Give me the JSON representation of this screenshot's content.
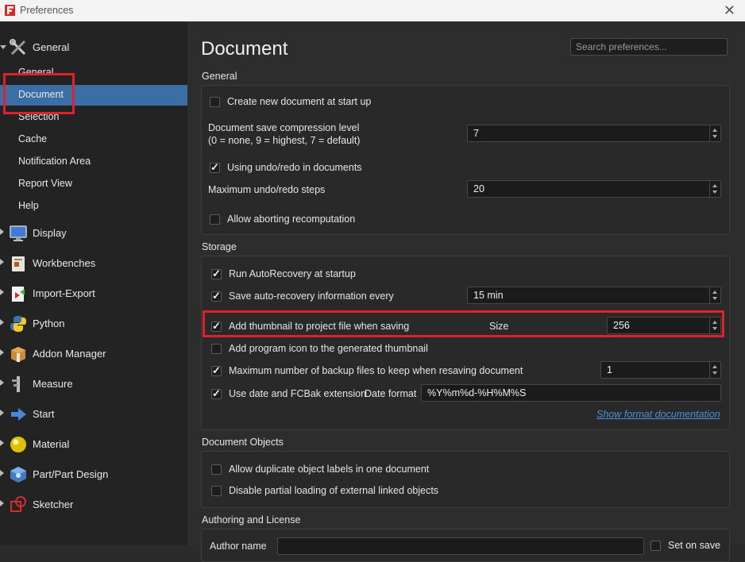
{
  "window": {
    "title": "Preferences",
    "close_glyph": "✕"
  },
  "sidebar": {
    "groups": [
      {
        "label": "General",
        "icon": "tools-icon",
        "expanded": true
      },
      {
        "label": "Display",
        "icon": "monitor-icon"
      },
      {
        "label": "Workbenches",
        "icon": "workbench-icon"
      },
      {
        "label": "Import-Export",
        "icon": "import-export-icon"
      },
      {
        "label": "Python",
        "icon": "python-icon"
      },
      {
        "label": "Addon Manager",
        "icon": "addon-box-icon"
      },
      {
        "label": "Measure",
        "icon": "caliper-icon"
      },
      {
        "label": "Start",
        "icon": "arrow-right-icon"
      },
      {
        "label": "Material",
        "icon": "sphere-icon"
      },
      {
        "label": "Part/Part Design",
        "icon": "part-cube-icon"
      },
      {
        "label": "Sketcher",
        "icon": "sketcher-icon"
      }
    ],
    "general_items": [
      "General",
      "Document",
      "Selection",
      "Cache",
      "Notification Area",
      "Report View",
      "Help"
    ],
    "selected_item": "Document"
  },
  "page": {
    "title": "Document",
    "search_placeholder": "Search preferences..."
  },
  "sections": {
    "general": {
      "title": "General",
      "create_new_doc": {
        "label": "Create new document at start up",
        "checked": false
      },
      "compression": {
        "label_line1": "Document save compression level",
        "label_line2": "(0 = none, 9 = highest, 7 = default)",
        "value": "7"
      },
      "undo_redo": {
        "label": "Using undo/redo in documents",
        "checked": true
      },
      "max_undo": {
        "label": "Maximum undo/redo steps",
        "value": "20"
      },
      "abort_recompute": {
        "label": "Allow aborting recomputation",
        "checked": false
      }
    },
    "storage": {
      "title": "Storage",
      "autorecovery": {
        "label": "Run AutoRecovery at startup",
        "checked": true
      },
      "save_autorecovery": {
        "label": "Save auto-recovery information every",
        "checked": true,
        "value": "15 min"
      },
      "thumbnail": {
        "label": "Add thumbnail to project file when saving",
        "checked": true,
        "size_label": "Size",
        "value": "256"
      },
      "program_icon": {
        "label": "Add program icon to the generated thumbnail",
        "checked": false
      },
      "max_backup": {
        "label": "Maximum number of backup files to keep when resaving document",
        "checked": true,
        "value": "1"
      },
      "date_ext": {
        "label": "Use date and FCBak extension",
        "checked": true,
        "format_label": "Date format",
        "format_value": "%Y%m%d-%H%M%S"
      },
      "doc_link": "Show format documentation"
    },
    "document_objects": {
      "title": "Document Objects",
      "duplicate_labels": {
        "label": "Allow duplicate object labels in one document",
        "checked": false
      },
      "partial_loading": {
        "label": "Disable partial loading of external linked objects",
        "checked": false
      }
    },
    "authoring": {
      "title": "Authoring and License",
      "author_label": "Author name",
      "set_label": "Set on save"
    }
  },
  "colors": {
    "accent": "#3a6ea5",
    "highlight": "#e0202a",
    "link": "#4a90d9"
  }
}
